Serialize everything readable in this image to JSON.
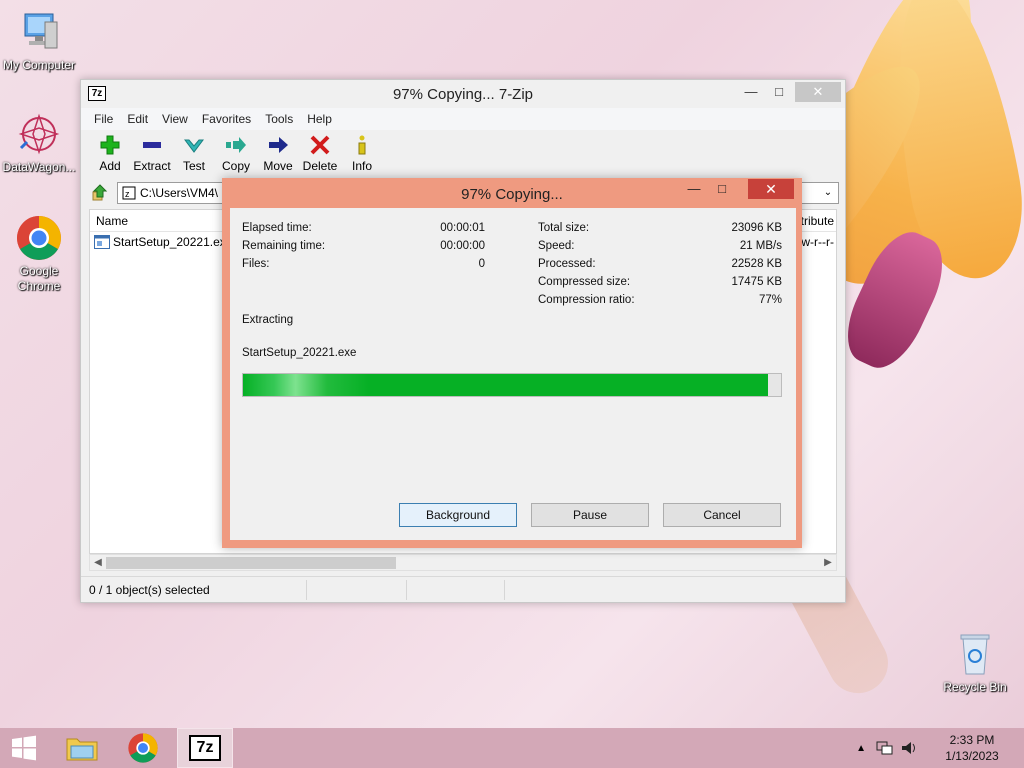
{
  "desktop": {
    "icons": [
      {
        "label": "My Computer"
      },
      {
        "label": "DataWagon..."
      },
      {
        "label": "Google Chrome"
      },
      {
        "label": "Recycle Bin"
      }
    ]
  },
  "main_window": {
    "title": "97% Copying... 7-Zip",
    "app_icon_text": "7z",
    "menu": [
      "File",
      "Edit",
      "View",
      "Favorites",
      "Tools",
      "Help"
    ],
    "toolbar": [
      {
        "label": "Add",
        "icon": "plus-icon",
        "color": "#1db31d"
      },
      {
        "label": "Extract",
        "icon": "minus-icon",
        "color": "#2b2b9c"
      },
      {
        "label": "Test",
        "icon": "check-icon",
        "color": "#2fb5b5"
      },
      {
        "label": "Copy",
        "icon": "copy-arrow-icon",
        "color": "#2aa890"
      },
      {
        "label": "Move",
        "icon": "move-arrow-icon",
        "color": "#1e2a8c"
      },
      {
        "label": "Delete",
        "icon": "delete-x-icon",
        "color": "#d11c1c"
      },
      {
        "label": "Info",
        "icon": "info-icon",
        "color": "#d8c41a"
      }
    ],
    "address": "C:\\Users\\VM4\\",
    "column_name": "Name",
    "column_attributes": "tribute",
    "file": {
      "name": "StartSetup_20221.exe",
      "attr": "w-r--r-"
    },
    "status": "0 / 1 object(s) selected"
  },
  "dialog": {
    "title": "97% Copying...",
    "left": [
      {
        "label": "Elapsed time:",
        "value": "00:00:01"
      },
      {
        "label": "Remaining time:",
        "value": "00:00:00"
      },
      {
        "label": "Files:",
        "value": "0"
      }
    ],
    "right": [
      {
        "label": "Total size:",
        "value": "23096 KB"
      },
      {
        "label": "Speed:",
        "value": "21 MB/s"
      },
      {
        "label": "Processed:",
        "value": "22528 KB"
      },
      {
        "label": "Compressed size:",
        "value": "17475 KB"
      },
      {
        "label": "Compression ratio:",
        "value": "77%"
      }
    ],
    "operation": "Extracting",
    "current_file": "StartSetup_20221.exe",
    "progress": 97.5,
    "buttons": {
      "background": "Background",
      "pause": "Pause",
      "cancel": "Cancel"
    }
  },
  "taskbar": {
    "time": "2:33 PM",
    "date": "1/13/2023",
    "active_app_text": "7z"
  }
}
